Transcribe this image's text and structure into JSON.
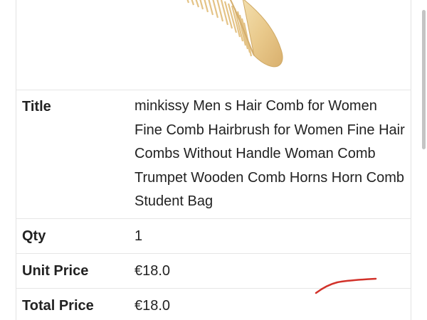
{
  "product_image": {
    "alt": "comb-image",
    "icon": "comb-icon"
  },
  "details": {
    "title": {
      "label": "Title",
      "value": "minkissy Men s Hair Comb for Women Fine Comb Hairbrush for Women Fine Hair Combs Without Handle Woman Comb Trumpet Wooden Comb Horns Horn Comb Student Bag"
    },
    "qty": {
      "label": "Qty",
      "value": "1"
    },
    "unit_price": {
      "label": "Unit Price",
      "value": "€18.0"
    },
    "total_price": {
      "label": "Total Price",
      "value": "€18.0"
    }
  },
  "colors": {
    "text": "#222222",
    "border": "#e6e6e6",
    "comb": "#e7c98e",
    "annotation": "#d2322a",
    "scrollbar": "#c4c4c4"
  }
}
